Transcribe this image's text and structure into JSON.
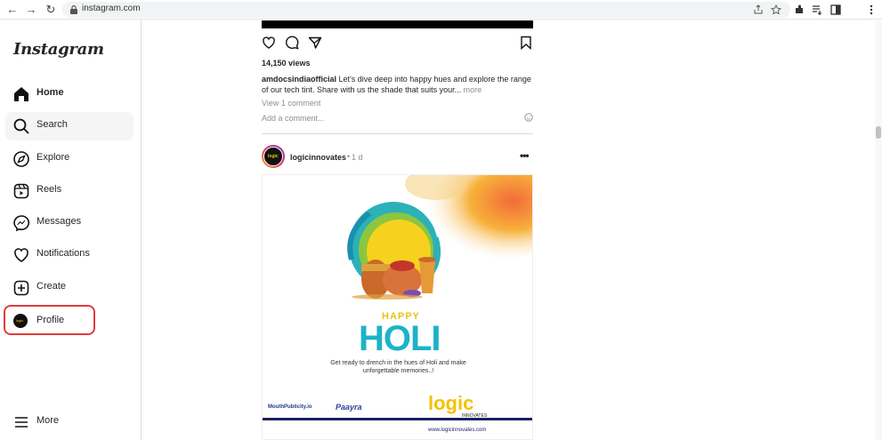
{
  "browser": {
    "url": "instagram.com",
    "back_glyph": "←",
    "forward_glyph": "→",
    "reload_glyph": "↻"
  },
  "sidebar": {
    "logo": "Instagram",
    "items": [
      {
        "label": "Home",
        "icon": "home-icon"
      },
      {
        "label": "Search",
        "icon": "search-icon"
      },
      {
        "label": "Explore",
        "icon": "compass-icon"
      },
      {
        "label": "Reels",
        "icon": "reels-icon"
      },
      {
        "label": "Messages",
        "icon": "messenger-icon"
      },
      {
        "label": "Notifications",
        "icon": "heart-icon"
      },
      {
        "label": "Create",
        "icon": "plus-square-icon"
      },
      {
        "label": "Profile",
        "icon": "avatar"
      }
    ],
    "more_label": "More",
    "avatar_text": "logic"
  },
  "previous_post": {
    "views": "14,150 views",
    "username": "amdocsindiaofficial",
    "caption": " Let's dive deep into happy hues and explore the range of our tech tint. Share with us the shade that suits your...",
    "more": " more",
    "view_comments": "View 1 comment",
    "add_comment_placeholder": "Add a comment..."
  },
  "post": {
    "username": "logicinnovates",
    "separator": "•",
    "time": "1 d",
    "menu": "•••",
    "avatar_text": "logic",
    "image": {
      "happy": "HAPPY",
      "holi": "HOLI",
      "tagline": "Get ready to drench in the hues of Holi and make unforgettable memories..!",
      "partner1": "MouthPublicity.io",
      "partner2": "Paayra",
      "brand": "logic",
      "brand_sub": "INNOVATES",
      "website": "www.logicinnovates.com"
    }
  },
  "colors": {
    "accent_red": "#e23a3a",
    "holi_teal": "#1cb3c8",
    "brand_yellow": "#f2c200",
    "navy": "#1b1f63"
  }
}
